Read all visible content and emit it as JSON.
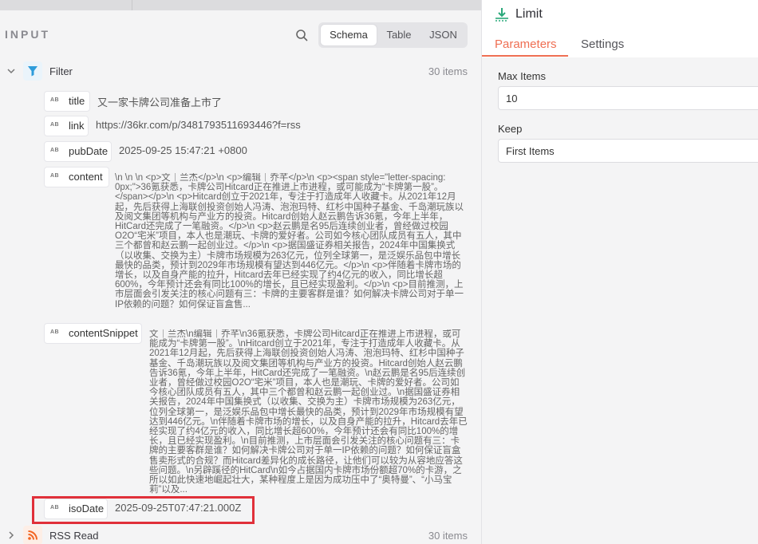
{
  "panel": {
    "input_label": "INPUT",
    "view_tabs": [
      "Schema",
      "Table",
      "JSON"
    ],
    "active_view": "Schema"
  },
  "nodes": {
    "filter": {
      "name": "Filter",
      "count": "30 items",
      "accent": "#2d9cdb"
    },
    "rss": {
      "name": "RSS Read",
      "count": "30 items",
      "accent": "#f26522"
    }
  },
  "fields": {
    "title": {
      "type": "AB",
      "name": "title",
      "value": "又一家卡牌公司准备上市了"
    },
    "link": {
      "type": "AB",
      "name": "link",
      "value": "https://36kr.com/p/3481793511693446?f=rss"
    },
    "pubDate": {
      "type": "AB",
      "name": "pubDate",
      "value": "2025-09-25 15:47:21 +0800"
    },
    "content": {
      "type": "AB",
      "name": "content",
      "value": "\\n \\n \\n <p>文｜兰杰</p>\\n <p>编辑｜乔芊</p>\\n <p><span style=\"letter-spacing: 0px;\">36氪获悉，卡牌公司Hitcard正在推进上市进程，或可能成为“卡牌第一股”。</span></p>\\n <p>Hitcard创立于2021年，专注于打造成年人收藏卡。从2021年12月起，先后获得上海联创投资创始人冯涛、泡泡玛特、红杉中国种子基金、千岛潮玩族以及阅文集团等机构与产业方的投资。Hitcard创始人赵云鹏告诉36氪，今年上半年，HitCard还完成了一笔融资。</p>\\n <p>赵云鹏是名95后连续创业者，曾经做过校园O2O“宅米”项目，本人也是潮玩、卡牌的爱好者。公司如今核心团队成员有五人，其中三个都曾和赵云鹏一起创业过。</p>\\n <p>据国盛证券相关报告，2024年中国集换式（以收集、交换为主）卡牌市场规模为263亿元，位列全球第一，是泛娱乐品包中增长最快的品类，预计到2029年市场规模有望达到446亿元。</p>\\n <p>伴随着卡牌市场的增长，以及自身产能的拉升，Hitcard去年已经实现了约4亿元的收入，同比增长超600%，今年预计还会有同比100%的增长，且已经实现盈利。</p>\\n <p>目前推测，上市层面会引发关注的核心问题有三：卡牌的主要客群是谁？如何解决卡牌公司对于单一IP依赖的问题？如何保证盲盒售..."
    },
    "contentSnippet": {
      "type": "AB",
      "name": "contentSnippet",
      "value": "文｜兰杰\\n编辑｜乔芊\\n36氪获悉，卡牌公司Hitcard正在推进上市进程，或可能成为“卡牌第一股”。\\nHitcard创立于2021年，专注于打造成年人收藏卡。从2021年12月起，先后获得上海联创投资创始人冯涛、泡泡玛特、红杉中国种子基金、千岛潮玩族以及阅文集团等机构与产业方的投资。Hitcard创始人赵云鹏告诉36氪，今年上半年，HitCard还完成了一笔融资。\\n赵云鹏是名95后连续创业者，曾经做过校园O2O“宅米”项目，本人也是潮玩、卡牌的爱好者。公司如今核心团队成员有五人，其中三个都曾和赵云鹏一起创业过。\\n据国盛证券相关报告，2024年中国集换式（以收集、交换为主）卡牌市场规模为263亿元，位列全球第一，是泛娱乐品包中增长最快的品类，预计到2029年市场规模有望达到446亿元。\\n伴随着卡牌市场的增长，以及自身产能的拉升，Hitcard去年已经实现了约4亿元的收入，同比增长超600%，今年预计还会有同比100%的增长，且已经实现盈利。\\n目前推测，上市层面会引发关注的核心问题有三：卡牌的主要客群是谁？如何解决卡牌公司对于单一IP依赖的问题？如何保证盲盒售卖形式的合规？而Hitcard差异化的成长路径，让他们可以较为从容地应答这些问题。\\n另辟蹊径的HitCard\\n如今占据国内卡牌市场份额超70%的卡游，之所以如此快速地崛起壮大，某种程度上是因为成功压中了“奥特曼”、“小马宝莉”以及..."
    },
    "isoDate": {
      "type": "AB",
      "name": "isoDate",
      "value": "2025-09-25T07:47:21.000Z"
    }
  },
  "settings_panel": {
    "title": "Limit",
    "tabs": [
      "Parameters",
      "Settings"
    ],
    "active_tab": "Parameters",
    "max_items_label": "Max Items",
    "max_items_value": "10",
    "keep_label": "Keep",
    "keep_value": "First Items",
    "accent": "#ef6f53"
  }
}
